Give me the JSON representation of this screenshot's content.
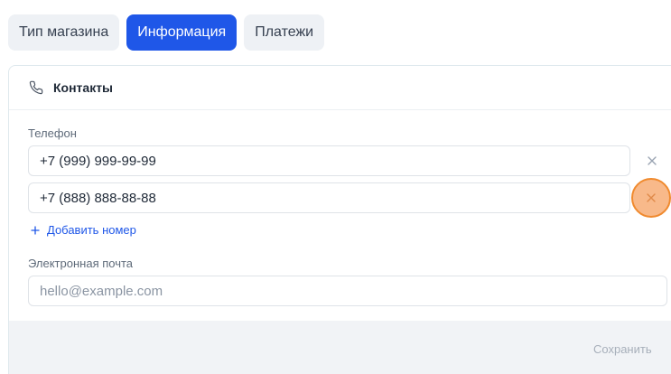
{
  "tabs": [
    {
      "label": "Тип магазина",
      "active": false
    },
    {
      "label": "Информация",
      "active": true
    },
    {
      "label": "Платежи",
      "active": false
    }
  ],
  "contacts": {
    "title": "Контакты",
    "icon": "phone-icon",
    "phone_label": "Телефон",
    "phones": [
      "+7 (999) 999-99-99",
      "+7 (888) 888-88-88"
    ],
    "add_phone_label": "Добавить номер",
    "email_label": "Электронная почта",
    "email_placeholder": "hello@example.com",
    "save_label": "Сохранить"
  },
  "colors": {
    "accent": "#1f57e8",
    "highlight_fill": "#f8b98a",
    "highlight_border": "#f08a2e"
  }
}
